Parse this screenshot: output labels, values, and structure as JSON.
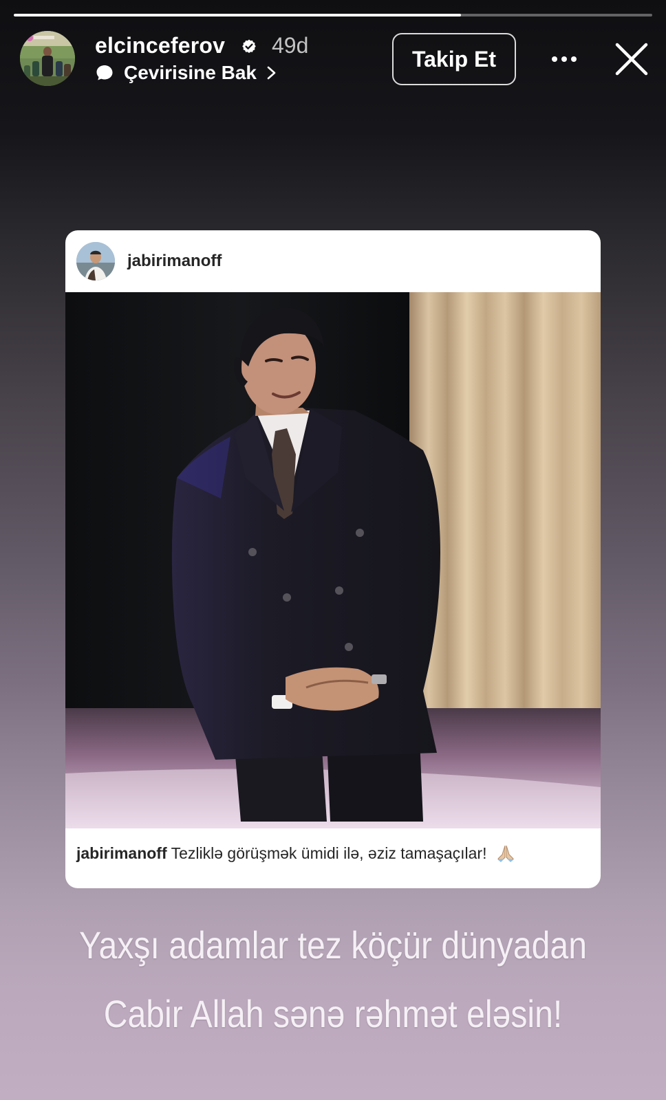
{
  "story": {
    "progress": 0.7,
    "username": "elcinceferov",
    "verified": true,
    "time_ago": "49d",
    "translate_label": "Çevirisine Bak",
    "follow_label": "Takip Et",
    "icons": {
      "verified": "verified-badge-icon",
      "translate": "speech-bubble-icon",
      "chevron": "chevron-right-icon",
      "more": "more-options-icon",
      "close": "close-icon"
    }
  },
  "shared_post": {
    "username": "jabirimanoff",
    "caption_user": "jabirimanoff",
    "caption_text": "Tezliklə görüşmək ümidi ilə, əziz tamaşaçılar!",
    "caption_emoji": "🙏"
  },
  "overlay": {
    "line1": "Yaxşı adamlar tez köçür dünyadan",
    "line2": "Cabir Allah sənə rəhmət eləsin!"
  },
  "colors": {
    "text_primary": "#ffffff",
    "card_bg": "#ffffff",
    "gradient_top": "#0f0f12",
    "gradient_bottom": "#c2aec3"
  }
}
